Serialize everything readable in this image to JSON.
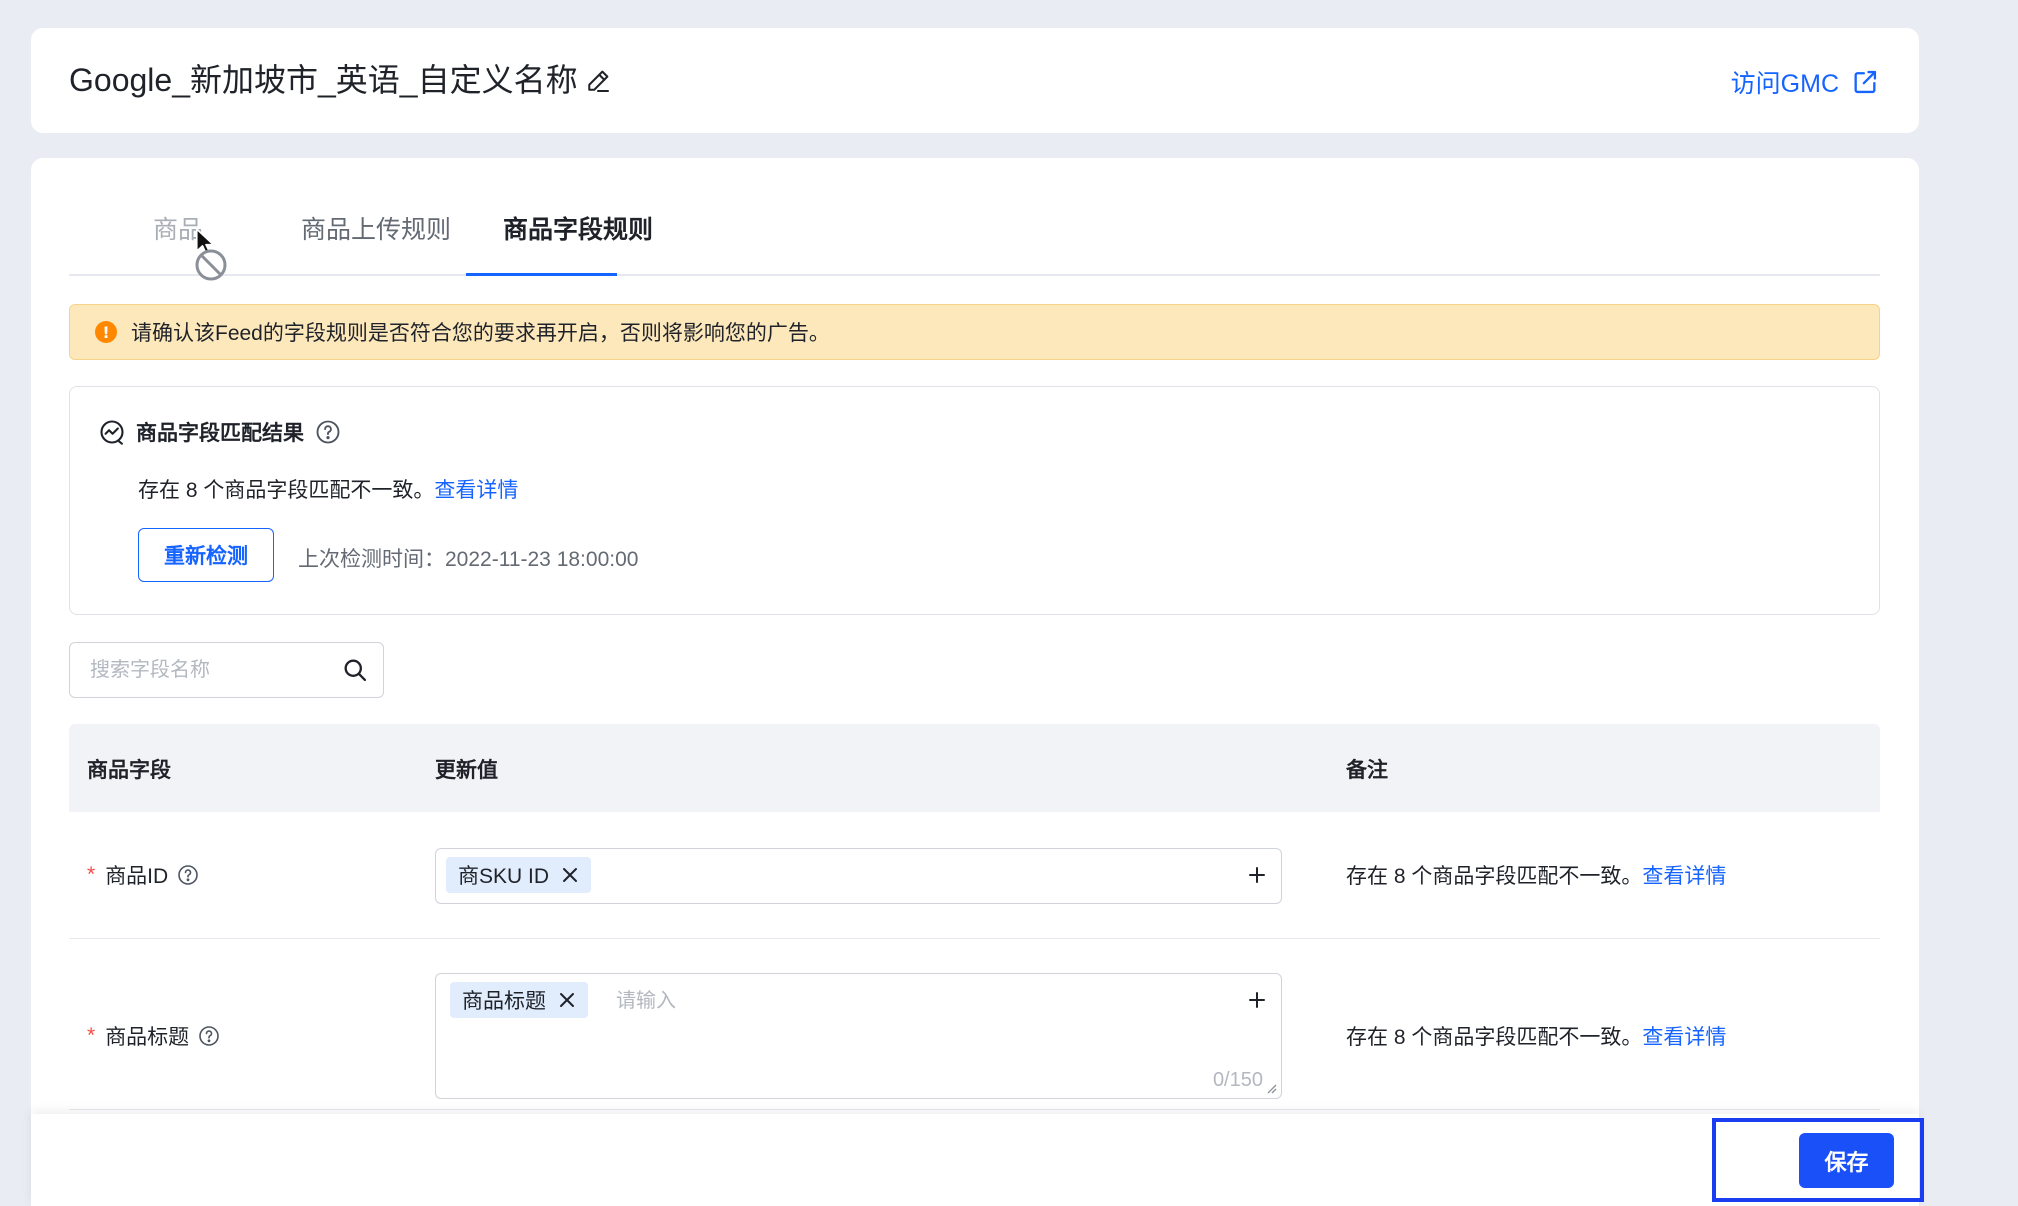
{
  "header": {
    "title": "Google_新加坡市_英语_自定义名称",
    "edit_icon": "edit-pencil-icon",
    "visit_link_label": "访问GMC",
    "visit_link_icon": "external-link-icon"
  },
  "tabs": [
    {
      "label": "商品",
      "state": "disabled"
    },
    {
      "label": "商品上传规则",
      "state": "normal"
    },
    {
      "label": "商品字段规则",
      "state": "active"
    }
  ],
  "alert": {
    "icon": "warning-icon",
    "text": "请确认该Feed的字段规则是否符合您的要求再开启，否则将影响您的广告。"
  },
  "match_result": {
    "title": "商品字段匹配结果",
    "icon": "chart-check-icon",
    "desc_text": "存在 8 个商品字段匹配不一致。",
    "detail_link": "查看详情",
    "recheck_button": "重新检测",
    "last_check_label": "上次检测时间：",
    "last_check_time": "2022-11-23 18:00:00"
  },
  "search": {
    "placeholder": "搜索字段名称",
    "value": ""
  },
  "table": {
    "columns": [
      "商品字段",
      "更新值",
      "备注"
    ],
    "rows": [
      {
        "required_mark": "*",
        "field": "商品ID",
        "tags": [
          "商SKU ID"
        ],
        "input_placeholder": "",
        "counter": "",
        "remark_text": "存在 8 个商品字段匹配不一致。",
        "remark_link": "查看详情"
      },
      {
        "required_mark": "*",
        "field": "商品标题",
        "tags": [
          "商品标题"
        ],
        "input_placeholder": "请输入",
        "counter": "0/150",
        "remark_text": "存在 8 个商品字段匹配不一致。",
        "remark_link": "查看详情"
      }
    ]
  },
  "footer": {
    "save_button": "保存"
  },
  "colors": {
    "primary": "#1664ff",
    "alert_bg": "#fde8bc",
    "warning": "#ff8800",
    "required": "#f54a45",
    "tag_bg": "#e1ecfd",
    "page_bg": "#e9edf3",
    "highlight_border": "#1a3cf2"
  }
}
